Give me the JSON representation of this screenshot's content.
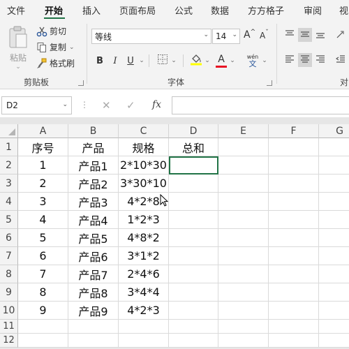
{
  "ribbon_tabs": [
    "文件",
    "开始",
    "插入",
    "页面布局",
    "公式",
    "数据",
    "方方格子",
    "审阅",
    "视"
  ],
  "active_tab": "开始",
  "clipboard": {
    "paste": "粘贴",
    "cut": "剪切",
    "copy": "复制",
    "format_painter": "格式刷",
    "group_label": "剪贴板"
  },
  "font": {
    "font_name": "等线",
    "font_size": "14",
    "bold": "B",
    "italic": "I",
    "underline": "U",
    "increase_size": "A",
    "decrease_size": "A",
    "font_color_letter": "A",
    "phonetic_top": "wén",
    "phonetic_bottom": "文",
    "group_label": "字体"
  },
  "alignment": {
    "group_label_partial": "对"
  },
  "formula_bar": {
    "name_box": "D2",
    "fx": "fx",
    "value": ""
  },
  "columns": [
    "A",
    "B",
    "C",
    "D",
    "E",
    "F",
    "G"
  ],
  "rows": [
    "1",
    "2",
    "3",
    "4",
    "5",
    "6",
    "7",
    "8",
    "9",
    "10",
    "11",
    "12"
  ],
  "cells": [
    [
      "序号",
      "产品",
      "规格",
      "总和"
    ],
    [
      "1",
      "产品1",
      "2*10*30",
      ""
    ],
    [
      "2",
      "产品2",
      "3*30*10",
      ""
    ],
    [
      "3",
      "产品3",
      "4*2*8",
      ""
    ],
    [
      "4",
      "产品4",
      "1*2*3",
      ""
    ],
    [
      "5",
      "产品5",
      "4*8*2",
      ""
    ],
    [
      "6",
      "产品6",
      "3*1*2",
      ""
    ],
    [
      "7",
      "产品7",
      "2*4*6",
      ""
    ],
    [
      "8",
      "产品8",
      "3*4*4",
      ""
    ],
    [
      "9",
      "产品9",
      "4*2*3",
      ""
    ]
  ],
  "selected_cell": "D2",
  "colors": {
    "accent": "#217346",
    "highlight_yellow": "#ffff00",
    "font_red": "#e81123"
  }
}
